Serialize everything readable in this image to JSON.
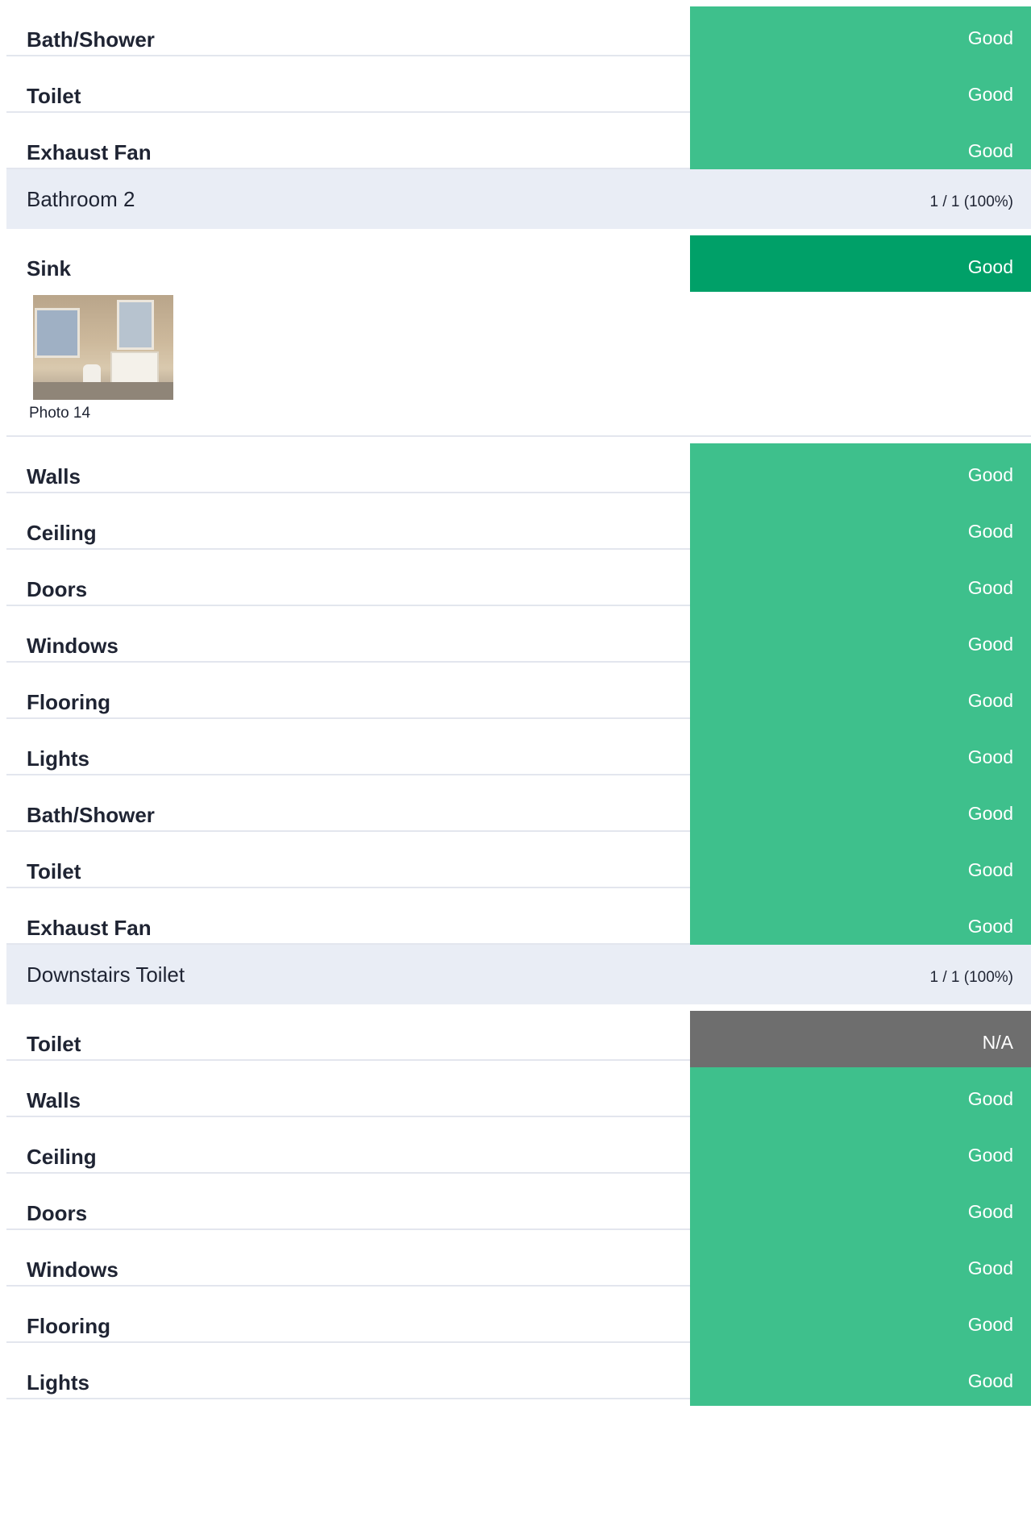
{
  "colors": {
    "good": "#3ec08c",
    "good_selected": "#00a068",
    "na": "#6e6e6e",
    "section_bg": "#e9edf5"
  },
  "rows_top": [
    {
      "name": "Bath/Shower",
      "status": "Good",
      "color": "good"
    },
    {
      "name": "Toilet",
      "status": "Good",
      "color": "good"
    },
    {
      "name": "Exhaust Fan",
      "status": "Good",
      "color": "good"
    }
  ],
  "section_bathroom2": {
    "title": "Bathroom 2",
    "count": "1 / 1 (100%)"
  },
  "sink": {
    "name": "Sink",
    "status": "Good",
    "color": "good_selected",
    "photo_caption": "Photo 14"
  },
  "rows_bathroom2": [
    {
      "name": "Walls",
      "status": "Good",
      "color": "good"
    },
    {
      "name": "Ceiling",
      "status": "Good",
      "color": "good"
    },
    {
      "name": "Doors",
      "status": "Good",
      "color": "good"
    },
    {
      "name": "Windows",
      "status": "Good",
      "color": "good"
    },
    {
      "name": "Flooring",
      "status": "Good",
      "color": "good"
    },
    {
      "name": "Lights",
      "status": "Good",
      "color": "good"
    },
    {
      "name": "Bath/Shower",
      "status": "Good",
      "color": "good"
    },
    {
      "name": "Toilet",
      "status": "Good",
      "color": "good"
    },
    {
      "name": "Exhaust Fan",
      "status": "Good",
      "color": "good"
    }
  ],
  "section_downstairs": {
    "title": "Downstairs Toilet",
    "count": "1 / 1 (100%)"
  },
  "rows_downstairs": [
    {
      "name": "Toilet",
      "status": "N/A",
      "color": "na"
    },
    {
      "name": "Walls",
      "status": "Good",
      "color": "good"
    },
    {
      "name": "Ceiling",
      "status": "Good",
      "color": "good"
    },
    {
      "name": "Doors",
      "status": "Good",
      "color": "good"
    },
    {
      "name": "Windows",
      "status": "Good",
      "color": "good"
    },
    {
      "name": "Flooring",
      "status": "Good",
      "color": "good"
    },
    {
      "name": "Lights",
      "status": "Good",
      "color": "good"
    }
  ]
}
